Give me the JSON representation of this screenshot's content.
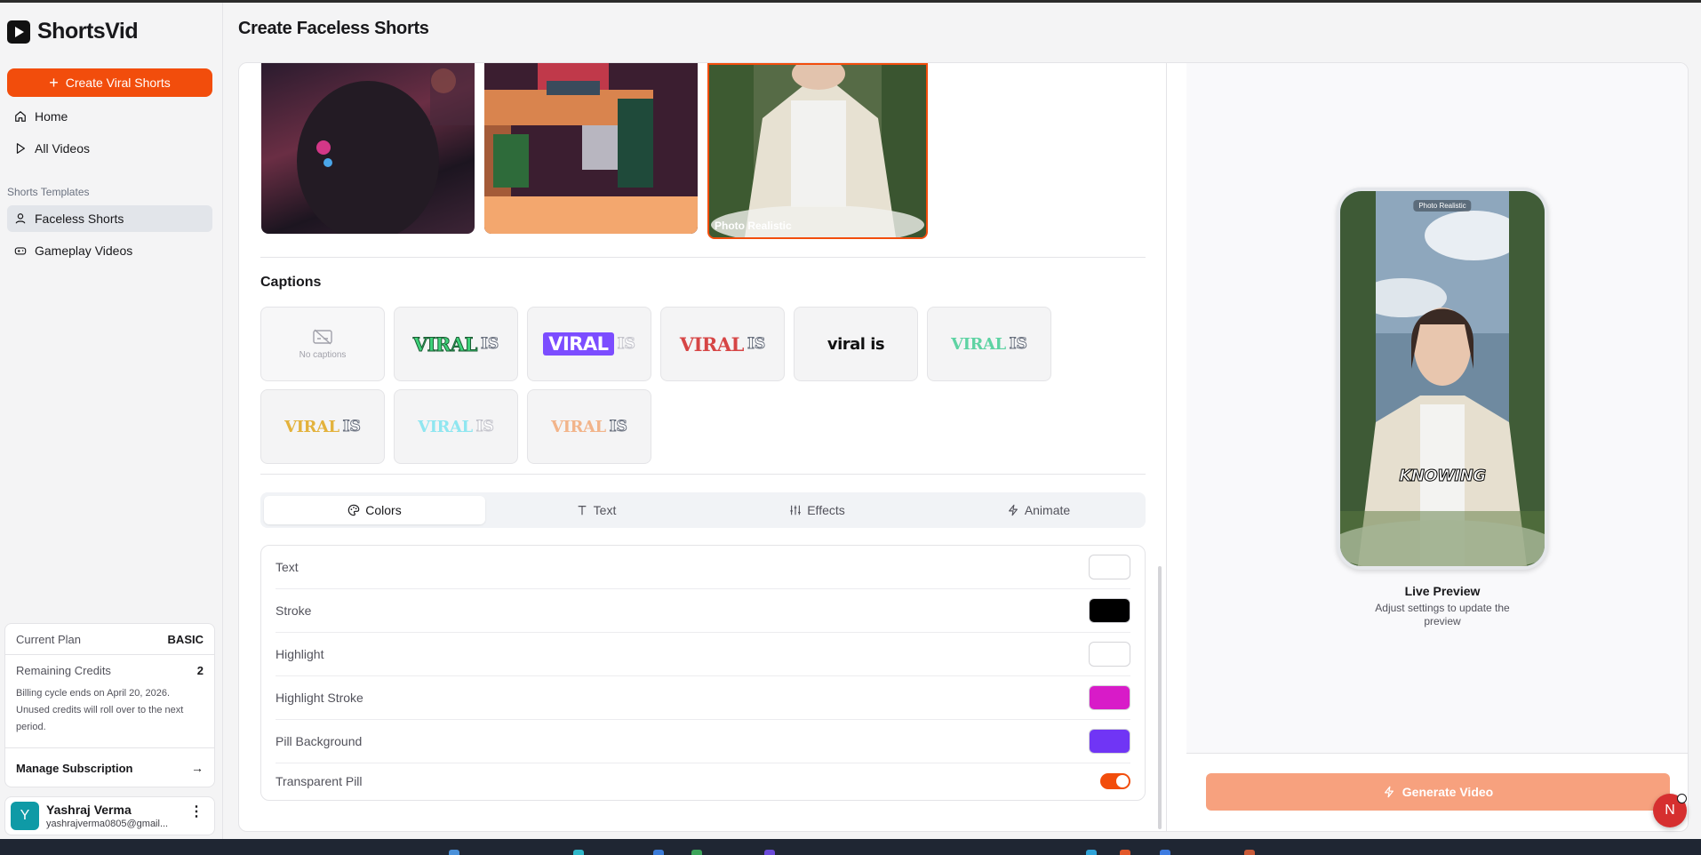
{
  "app": {
    "name": "ShortsVid",
    "page_title": "Create Faceless Shorts"
  },
  "sidebar": {
    "create_button": "Create Viral Shorts",
    "nav": [
      {
        "label": "Home",
        "icon": "home-icon"
      },
      {
        "label": "All Videos",
        "icon": "play-icon"
      }
    ],
    "section_label": "Shorts Templates",
    "templates": [
      {
        "label": "Faceless Shorts",
        "icon": "user-icon",
        "active": true
      },
      {
        "label": "Gameplay Videos",
        "icon": "gamepad-icon",
        "active": false
      }
    ],
    "plan": {
      "current_plan_label": "Current Plan",
      "current_plan_value": "BASIC",
      "credits_label": "Remaining Credits",
      "credits_value": "2",
      "note": "Billing cycle ends on April 20, 2026. Unused credits will roll over to the next period.",
      "manage": "Manage Subscription"
    },
    "user": {
      "initial": "Y",
      "name": "Yashraj Verma",
      "email": "yashrajverma0805@gmail..."
    }
  },
  "styles": {
    "selected_label": "Photo Realistic"
  },
  "captions": {
    "title": "Captions",
    "no_captions_label": "No captions",
    "tiles": [
      {
        "main": "VIRAL",
        "is": "IS",
        "color": "#3fd27a"
      },
      {
        "main": "VIRAL",
        "is": "IS",
        "color": "#ffffff",
        "bg": "#7c4dff"
      },
      {
        "main": "VIRAL",
        "is": "IS",
        "color": "#d64545"
      },
      {
        "main": "viral is",
        "is": "",
        "color": "#111111"
      },
      {
        "main": "VIRAL",
        "is": "IS",
        "color": "#5ed3a3"
      },
      {
        "main": "VIRAL",
        "is": "IS",
        "color": "#e3b23c"
      },
      {
        "main": "VIRAL",
        "is": "IS",
        "color": "#8fe6f0"
      },
      {
        "main": "VIRAL",
        "is": "IS",
        "color": "#f2b48a"
      }
    ]
  },
  "tabs": [
    {
      "label": "Colors",
      "icon": "palette-icon",
      "active": true
    },
    {
      "label": "Text",
      "icon": "text-icon",
      "active": false
    },
    {
      "label": "Effects",
      "icon": "sliders-icon",
      "active": false
    },
    {
      "label": "Animate",
      "icon": "bolt-icon",
      "active": false
    }
  ],
  "colors": [
    {
      "label": "Text",
      "value": "#ffffff"
    },
    {
      "label": "Stroke",
      "value": "#000000"
    },
    {
      "label": "Highlight",
      "value": "#ffffff"
    },
    {
      "label": "Highlight Stroke",
      "value": "#d81bc8"
    },
    {
      "label": "Pill Background",
      "value": "#7035f5"
    }
  ],
  "transparent_pill": {
    "label": "Transparent Pill",
    "on": true
  },
  "preview": {
    "tag": "Photo Realistic",
    "caption": "KNOWING",
    "title": "Live Preview",
    "subtitle": "Adjust settings to update the preview",
    "generate": "Generate Video"
  },
  "fab_initial": "N",
  "theme": {
    "accent": "#f24d0c",
    "accent_disabled": "#f7a17e"
  }
}
